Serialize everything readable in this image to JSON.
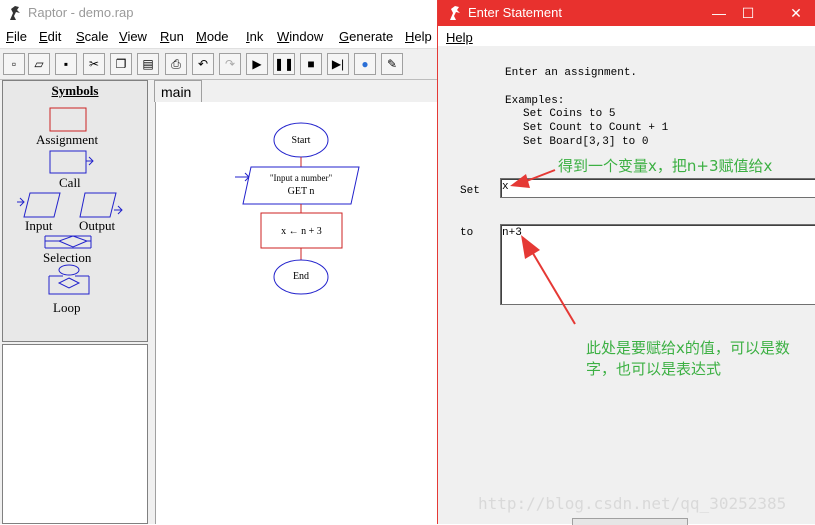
{
  "raptor": {
    "title": "Raptor - demo.rap",
    "menu": [
      {
        "label": "File",
        "accel": "F",
        "rest": "ile"
      },
      {
        "label": "Edit",
        "accel": "E",
        "rest": "dit"
      },
      {
        "label": "Scale",
        "accel": "S",
        "rest": "cale"
      },
      {
        "label": "View",
        "accel": "V",
        "rest": "iew"
      },
      {
        "label": "Run",
        "accel": "R",
        "rest": "un"
      },
      {
        "label": "Mode",
        "accel": "M",
        "rest": "ode"
      },
      {
        "label": "Ink",
        "accel": "I",
        "rest": "nk"
      },
      {
        "label": "Window",
        "accel": "W",
        "rest": "indow"
      },
      {
        "label": "Generate",
        "accel": "G",
        "rest": "enerate"
      },
      {
        "label": "Help",
        "accel": "H",
        "rest": "elp"
      }
    ],
    "symbols": {
      "title": "Symbols",
      "assignment": "Assignment",
      "call": "Call",
      "input": "Input",
      "output": "Output",
      "selection": "Selection",
      "loop": "Loop"
    },
    "tab": "main",
    "flow": {
      "start": "Start",
      "input_prompt": "\"Input a number\"",
      "input_var": "GET n",
      "assign": "x ← n + 3",
      "end": "End"
    }
  },
  "dialog": {
    "title": "Enter Statement",
    "menu_help": "Help",
    "instructions": "Enter an assignment.",
    "examples_header": "Examples:",
    "examples": [
      "Set Coins to 5",
      "Set Count to Count + 1",
      "Set Board[3,3] to 0"
    ],
    "set_label": "Set",
    "set_value": "x",
    "to_label": "to",
    "to_value": "n+3",
    "annotation_1": "得到一个变量x，把n+3赋值给x",
    "annotation_2": "此处是要赋给x的值，可以是数字，也可以是表达式"
  },
  "watermark": "http://blog.csdn.net/qq_30252385",
  "colors": {
    "dialog_title_bg": "#e8312e",
    "annotation": "#3cb043",
    "flow_blue": "#2222cc",
    "flow_red": "#cc2222"
  }
}
